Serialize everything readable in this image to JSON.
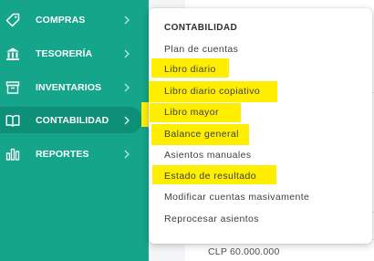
{
  "sidebar": {
    "items": [
      {
        "label": "COMPRAS",
        "icon": "tag-icon"
      },
      {
        "label": "TESORERÍA",
        "icon": "bank-icon"
      },
      {
        "label": "INVENTARIOS",
        "icon": "box-icon"
      },
      {
        "label": "CONTABILIDAD",
        "icon": "book-icon",
        "active": true
      },
      {
        "label": "REPORTES",
        "icon": "bar-chart-icon"
      }
    ]
  },
  "menu": {
    "title": "CONTABILIDAD",
    "items": [
      {
        "label": "Plan de cuentas",
        "highlighted": false
      },
      {
        "label": "Libro diario",
        "highlighted": true
      },
      {
        "label": "Libro diario copiativo",
        "highlighted": true
      },
      {
        "label": "Libro mayor",
        "highlighted": true
      },
      {
        "label": "Balance general",
        "highlighted": true
      },
      {
        "label": "Asientos manuales",
        "highlighted": false
      },
      {
        "label": "Estado de resultado",
        "highlighted": true
      },
      {
        "label": "Modificar cuentas masivamente",
        "highlighted": false
      },
      {
        "label": "Reprocesar asientos",
        "highlighted": false
      }
    ]
  },
  "background": {
    "amount": "CLP 60.000.000"
  },
  "colors": {
    "sidebar": "#14a58a",
    "sidebar_active": "#0e8f77",
    "highlight": "#ffee00"
  }
}
